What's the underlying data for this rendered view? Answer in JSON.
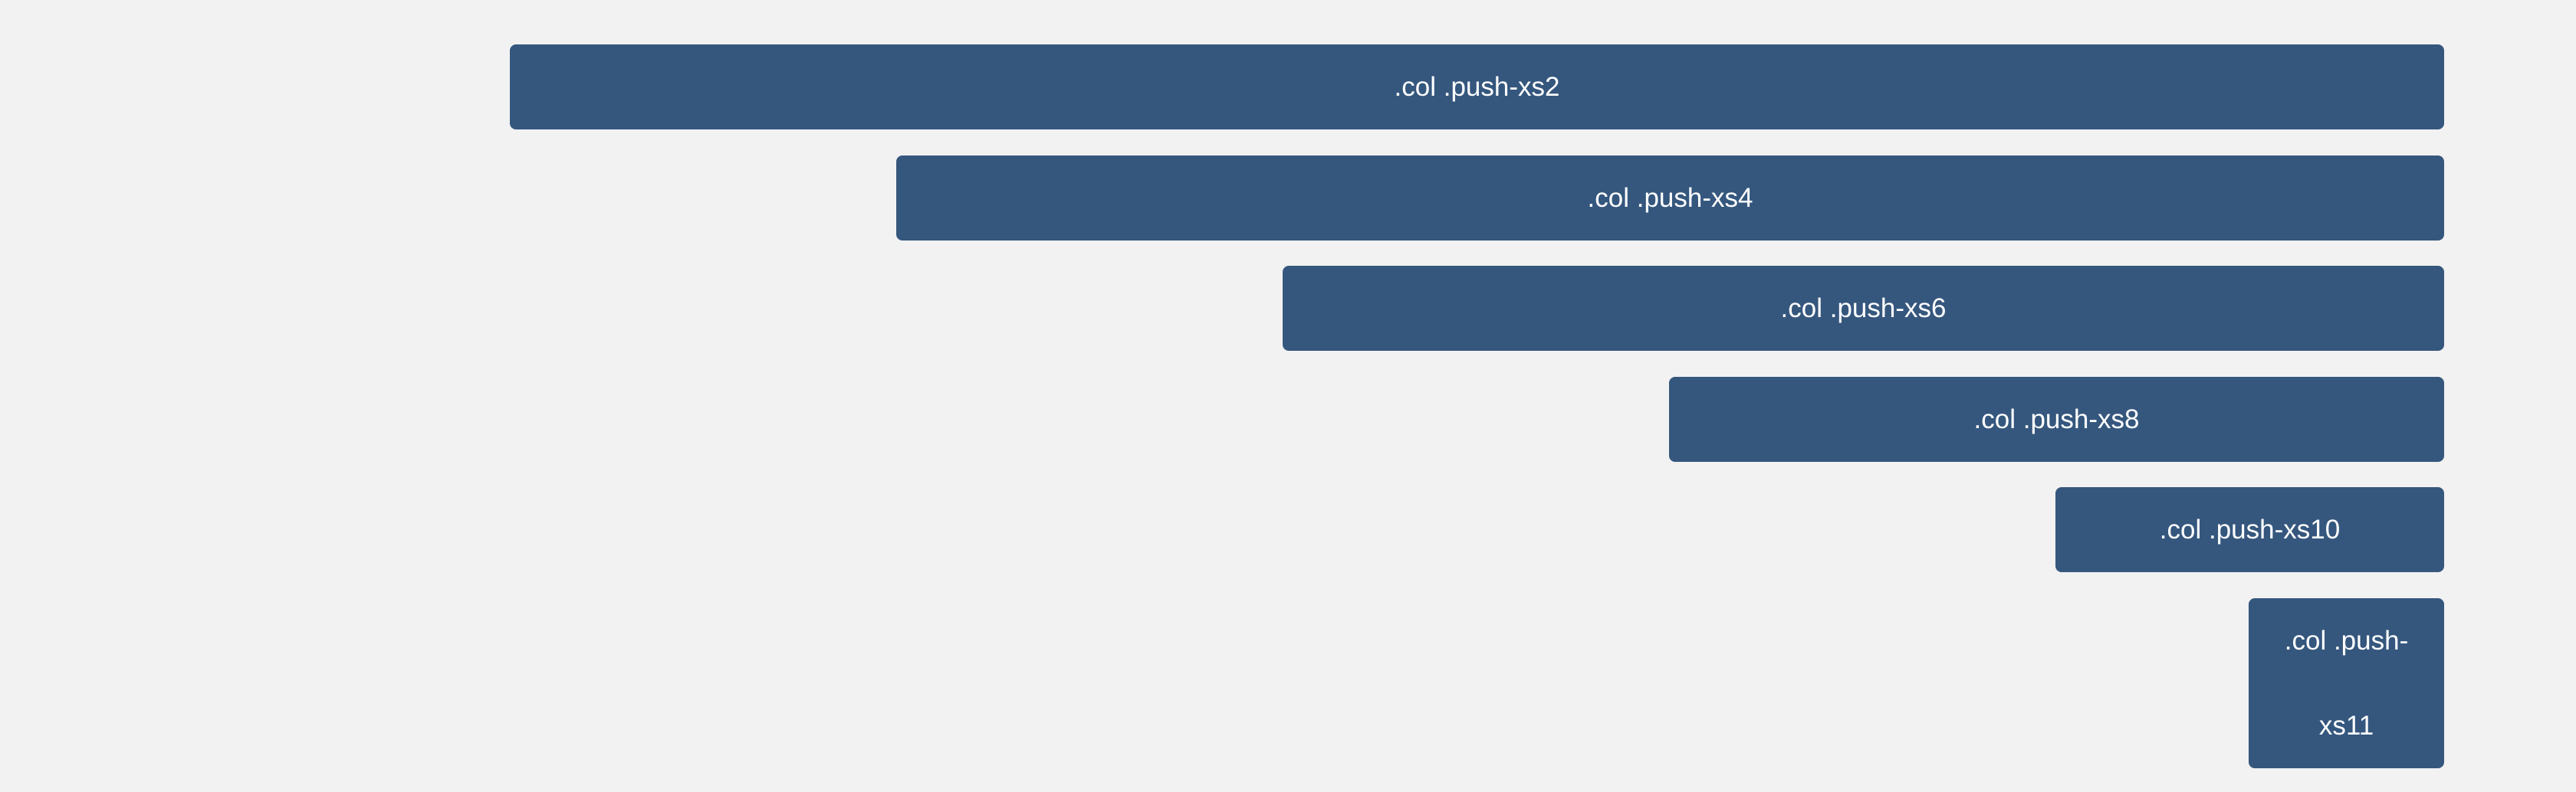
{
  "colors": {
    "background": "#f2f2f2",
    "block": "#35577e",
    "text": "#ffffff"
  },
  "rows": [
    {
      "label": ".col .push-xs2"
    },
    {
      "label": ".col .push-xs4"
    },
    {
      "label": ".col .push-xs6"
    },
    {
      "label": ".col .push-xs8"
    },
    {
      "label": ".col .push-xs10"
    },
    {
      "label_line1": ".col .push-",
      "label_line2": "xs11"
    }
  ]
}
